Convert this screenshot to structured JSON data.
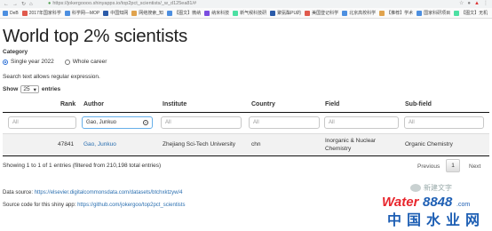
{
  "browser": {
    "url": "https://jokergoooo.shinyapps.io/top2pct_scientists/_w_d125ea81/#",
    "bookmarks": [
      {
        "label": "DeB",
        "color": "#4d8fe0"
      },
      {
        "label": "2017年国家科学",
        "color": "#e05a4d"
      },
      {
        "label": "科学网—MOP",
        "color": "#4d8fe0"
      },
      {
        "label": "中国知网",
        "color": "#2a5aa8"
      },
      {
        "label": "网络搜索_知",
        "color": "#e0a34d"
      },
      {
        "label": "【图文】微纳",
        "color": "#4d8fe0"
      },
      {
        "label": "纳米科技",
        "color": "#7a4de0"
      },
      {
        "label": "新气候科技研",
        "color": "#4de0a3"
      },
      {
        "label": "聚氨酯PU的",
        "color": "#2a5aa8"
      },
      {
        "label": "美国登记科学",
        "color": "#e05a4d"
      },
      {
        "label": "北京高校科学",
        "color": "#4d8fe0"
      },
      {
        "label": "【推荐】学术",
        "color": "#e0a34d"
      },
      {
        "label": "国家科研项目",
        "color": "#4d8fe0"
      },
      {
        "label": "【图文】无机",
        "color": "#4de0a3"
      }
    ]
  },
  "page": {
    "title": "World top 2% scientists",
    "category_label": "Category",
    "category_options": [
      {
        "label": "Single year 2022",
        "selected": true
      },
      {
        "label": "Whole career",
        "selected": false
      }
    ],
    "help_text": "Search text allows regular expression.",
    "show_label": "Show",
    "show_value": "25",
    "entries_label": "entries"
  },
  "table": {
    "columns": [
      "Rank",
      "Author",
      "Institute",
      "Country",
      "Field",
      "Sub-field"
    ],
    "filters": {
      "rank": "All",
      "author": "Gao, Junkuo",
      "institute": "All",
      "country": "All",
      "field": "All",
      "subfield": "All"
    },
    "rows": [
      {
        "rank": "47841",
        "author": "Gao, Junkuo",
        "institute": "Zhejiang Sci-Tech University",
        "country": "chn",
        "field": "Inorganic & Nuclear Chemistry",
        "subfield": "Organic Chemistry"
      }
    ]
  },
  "info": "Showing 1 to 1 of 1 entries (filtered from 210,198 total entries)",
  "pager": {
    "previous": "Previous",
    "page": "1",
    "next": "Next"
  },
  "footer": {
    "data_source_label": "Data source:",
    "data_source_url": "https://elsevier.digitalcommonsdata.com/datasets/btchxktzyw/4",
    "source_code_label": "Source code for this shiny app:",
    "source_code_url": "https://github.com/jokergoo/top2pct_scientists"
  },
  "watermark": {
    "wechat": "新建文字",
    "brand_top": "Water8848.com",
    "brand_bottom": "中国水业网",
    "colors": {
      "red": "#e8262d",
      "blue": "#1e5fb4"
    }
  }
}
